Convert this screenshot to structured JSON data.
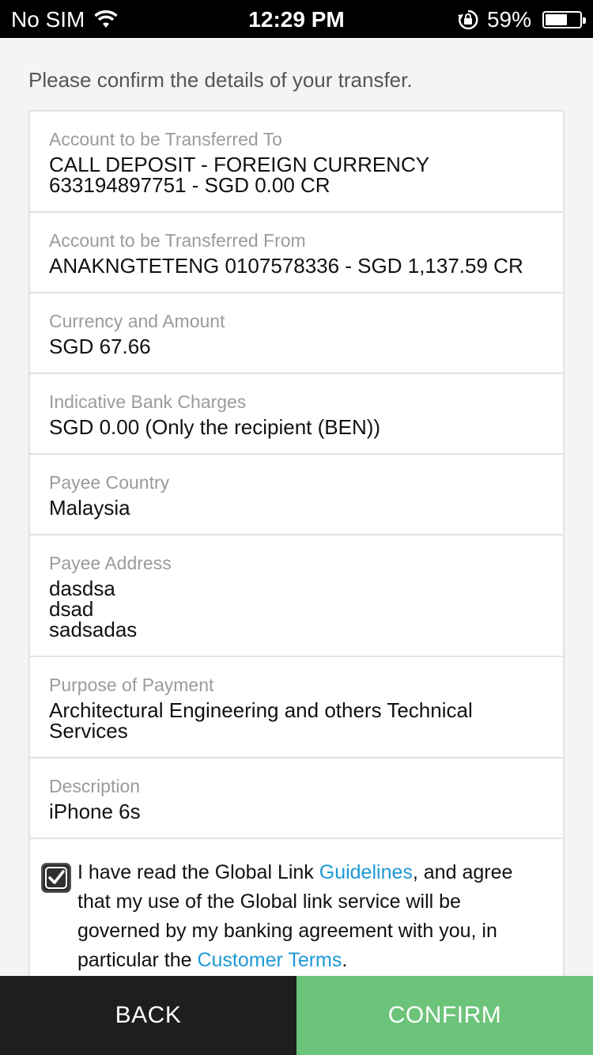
{
  "status_bar": {
    "carrier": "No SIM",
    "time": "12:29 PM",
    "battery": "59%",
    "battery_level": 0.59
  },
  "intro": "Please confirm the details of your transfer.",
  "details": [
    {
      "label": "Account to be Transferred To",
      "value": "CALL DEPOSIT - FOREIGN CURRENCY\n633194897751 - SGD 0.00 CR"
    },
    {
      "label": "Account to be Transferred From",
      "value": "ANAKNGTETENG 0107578336 - SGD 1,137.59 CR"
    },
    {
      "label": "Currency and Amount",
      "value": "SGD 67.66"
    },
    {
      "label": "Indicative Bank Charges",
      "value": "SGD 0.00 (Only the recipient (BEN))"
    },
    {
      "label": "Payee Country",
      "value": "Malaysia"
    },
    {
      "label": "Payee Address",
      "value": "dasdsa\ndsad\nsadsadas"
    },
    {
      "label": "Purpose of Payment",
      "value": "Architectural Engineering and others Technical\nServices"
    },
    {
      "label": "Description",
      "value": "iPhone 6s"
    }
  ],
  "agreement": {
    "checked": true,
    "text_1": "I have read the Global Link ",
    "link_1": "Guidelines",
    "text_2": ", and agree that my use of the Global link service will be governed by my banking agreement with you, in particular the ",
    "link_2": "Customer Terms",
    "text_3": "."
  },
  "buttons": {
    "back": "BACK",
    "confirm": "CONFIRM"
  },
  "colors": {
    "confirm_bg": "#6cc37a",
    "back_bg": "#1e1e1e",
    "link": "#1e9ad6"
  }
}
